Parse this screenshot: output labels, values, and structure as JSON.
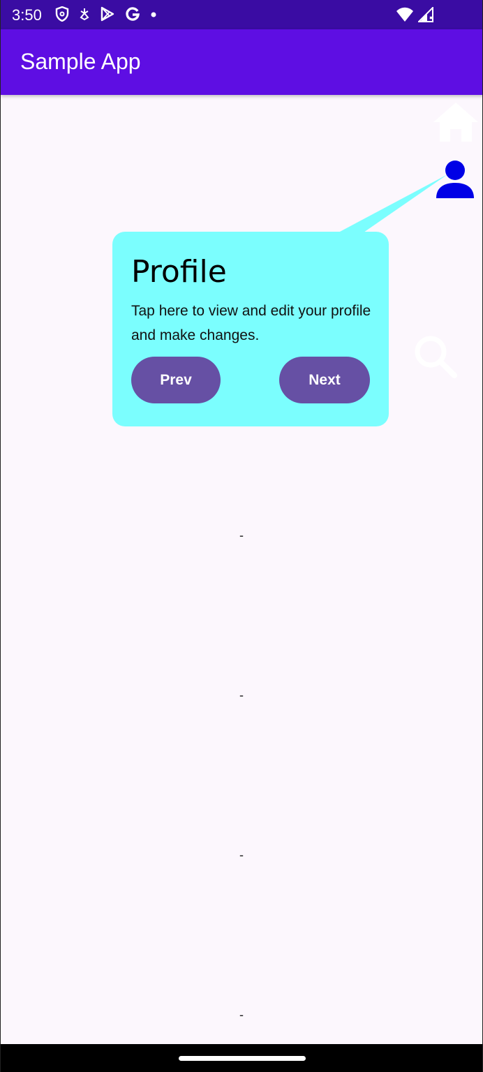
{
  "status_bar": {
    "time": "3:50",
    "icons": [
      "shield-icon",
      "fan-icon",
      "play-store-icon",
      "google-icon",
      "dot-icon"
    ],
    "right_icons": [
      "wifi-icon",
      "signal-icon"
    ]
  },
  "app_bar": {
    "title": "Sample App"
  },
  "side_icons": [
    "home-icon",
    "person-icon",
    "search-icon"
  ],
  "tooltip": {
    "title": "Profile",
    "body": "Tap here to view and edit your profile and make changes.",
    "prev_label": "Prev",
    "next_label": "Next"
  },
  "list": {
    "items": [
      "-",
      "-",
      "-",
      "-"
    ]
  },
  "colors": {
    "status_bar": "#3a0ca3",
    "app_bar": "#5e0ee3",
    "tooltip_bg": "#7bfefe",
    "button_bg": "#6650a4",
    "person_icon": "#0000e6"
  }
}
